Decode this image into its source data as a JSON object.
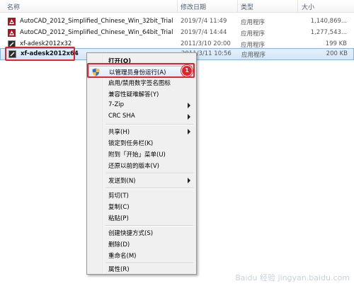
{
  "columns": {
    "name": "名称",
    "date": "修改日期",
    "type": "类型",
    "size": "大小"
  },
  "files": [
    {
      "name": "AutoCAD_2012_Simplified_Chinese_Win_32bit_Trial",
      "date": "2019/7/4 11:49",
      "type": "应用程序",
      "size": "1,140,869...",
      "icon": "autocad-icon"
    },
    {
      "name": "AutoCAD_2012_Simplified_Chinese_Win_64bit_Trial",
      "date": "2019/7/4 14:44",
      "type": "应用程序",
      "size": "1,277,543...",
      "icon": "autocad-icon"
    },
    {
      "name": "xf-adesk2012x32",
      "date": "2011/3/10 20:00",
      "type": "应用程序",
      "size": "199 KB",
      "icon": "keygen-icon"
    },
    {
      "name": "xf-adesk2012x64",
      "date": "2011/3/11 10:56",
      "type": "应用程序",
      "size": "200 KB",
      "icon": "keygen-icon"
    }
  ],
  "menu": {
    "open": "打开(O)",
    "run_as_admin": "以管理员身份运行(A)",
    "signature": "启用/禁用数字签名图标",
    "compat": "兼容性疑难解答(Y)",
    "zip": "7-Zip",
    "crc": "CRC SHA",
    "share": "共享(H)",
    "pin_taskbar": "锁定到任务栏(K)",
    "pin_start": "附到「开始」菜单(U)",
    "restore": "还原以前的版本(V)",
    "sendto": "发送到(N)",
    "cut": "剪切(T)",
    "copy": "复制(C)",
    "paste": "粘贴(P)",
    "shortcut": "创建快捷方式(S)",
    "delete": "删除(D)",
    "rename": "重命名(M)",
    "properties": "属性(R)"
  },
  "annotation": {
    "step": "1"
  },
  "watermark": "Baidu 经验 jingyan.baidu.com",
  "colors": {
    "accent_red": "#e3242b",
    "selection": "#d3e6f8"
  }
}
